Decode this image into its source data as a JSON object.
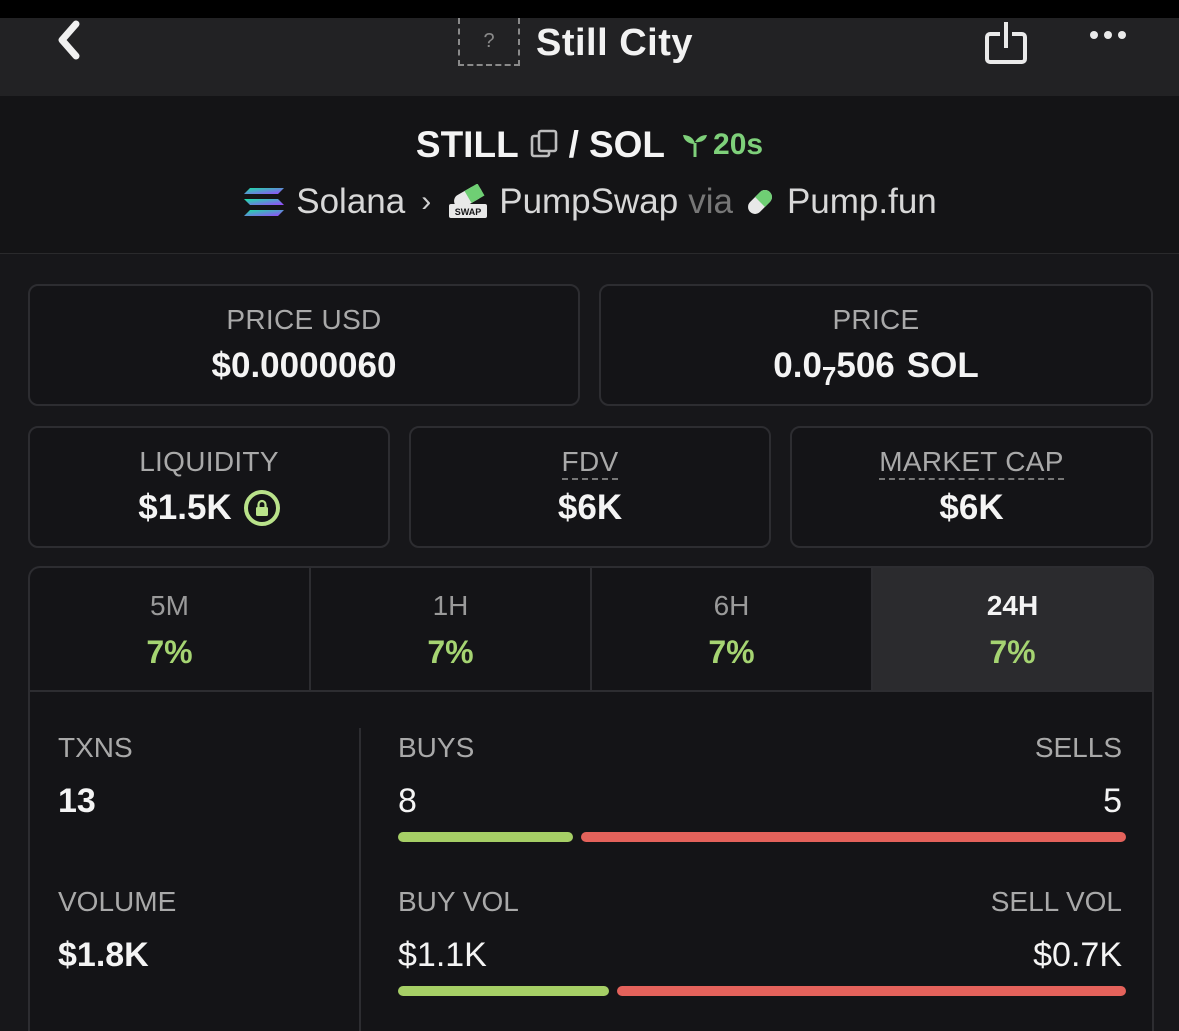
{
  "nav": {
    "title": "Still City",
    "token_placeholder": "?"
  },
  "pair": {
    "base": "STILL",
    "separator": "/",
    "quote": "SOL",
    "age": "20s"
  },
  "route": {
    "chain": "Solana",
    "dex": "PumpSwap",
    "via": "via",
    "launchpad": "Pump.fun",
    "dex_icon_text": "SWAP"
  },
  "price_usd": {
    "label": "PRICE USD",
    "value": "$0.0000060"
  },
  "price_native": {
    "label": "PRICE",
    "prefix": "0.0",
    "subscript": "7",
    "digits": "506",
    "unit": "SOL"
  },
  "liquidity": {
    "label": "LIQUIDITY",
    "value": "$1.5K"
  },
  "fdv": {
    "label": "FDV",
    "value": "$6K"
  },
  "market_cap": {
    "label": "MARKET CAP",
    "value": "$6K"
  },
  "timeframes": [
    {
      "label": "5M",
      "change": "7%"
    },
    {
      "label": "1H",
      "change": "7%"
    },
    {
      "label": "6H",
      "change": "7%"
    },
    {
      "label": "24H",
      "change": "7%"
    }
  ],
  "active_timeframe": "24H",
  "stats": {
    "txns_label": "TXNS",
    "txns": "13",
    "buys_label": "BUYS",
    "buys": "8",
    "sells_label": "SELLS",
    "sells": "5",
    "volume_label": "VOLUME",
    "volume": "$1.8K",
    "buy_vol_label": "BUY VOL",
    "buy_vol": "$1.1K",
    "sell_vol_label": "SELL VOL",
    "sell_vol": "$0.7K",
    "buy_share_txns": 0.24,
    "buy_share_volume": 0.29
  },
  "colors": {
    "positive": "#a5d472",
    "buy_bar": "#a6cf66",
    "sell_bar": "#e4625b",
    "age": "#7ed07a"
  },
  "icons": [
    "chevron-left-icon",
    "share-icon",
    "more-icon",
    "copy-icon",
    "sprout-icon",
    "solana-icon",
    "pumpswap-icon",
    "pill-icon",
    "lock-icon"
  ]
}
